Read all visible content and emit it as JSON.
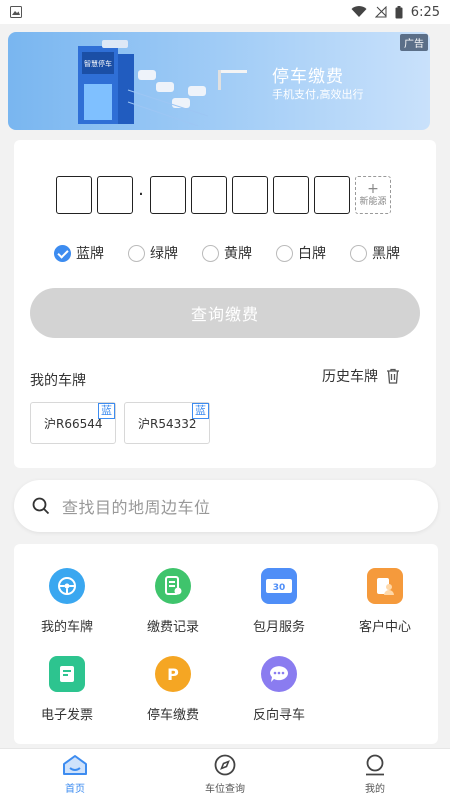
{
  "status_bar": {
    "time": "6:25"
  },
  "banner": {
    "ad_tag": "广告",
    "title": "停车缴费",
    "subtitle": "手机支付,高效出行",
    "building_sign": "智慧停车",
    "brand_color": "#79b6f0"
  },
  "plate_input": {
    "new_energy_plus": "+",
    "new_energy_label": "新能源"
  },
  "plate_colors": [
    {
      "label": "蓝牌",
      "checked": true
    },
    {
      "label": "绿牌",
      "checked": false
    },
    {
      "label": "黄牌",
      "checked": false
    },
    {
      "label": "白牌",
      "checked": false
    },
    {
      "label": "黑牌",
      "checked": false
    }
  ],
  "query_button": "查询缴费",
  "my_plates_title": "我的车牌",
  "history_title": "历史车牌",
  "plates": [
    {
      "number": "沪R66544",
      "tag": "蓝"
    },
    {
      "number": "沪R54332",
      "tag": "蓝"
    }
  ],
  "search": {
    "placeholder": "查找目的地周边车位"
  },
  "services": [
    {
      "label": "我的车牌",
      "icon": "steering-wheel-icon",
      "color": "#3aa7f0"
    },
    {
      "label": "缴费记录",
      "icon": "receipt-icon",
      "color": "#3fc46c"
    },
    {
      "label": "包月服务",
      "icon": "ticket-30-icon",
      "color": "#4f8ef7"
    },
    {
      "label": "客户中心",
      "icon": "customer-icon",
      "color": "#f59a3c"
    },
    {
      "label": "电子发票",
      "icon": "invoice-icon",
      "color": "#2dc48f"
    },
    {
      "label": "停车缴费",
      "icon": "parking-p-icon",
      "color": "#f5a623"
    },
    {
      "label": "反向寻车",
      "icon": "chat-bubble-icon",
      "color": "#8a7cf0"
    }
  ],
  "tabs": [
    {
      "label": "首页",
      "icon": "home-icon",
      "active": true
    },
    {
      "label": "车位查询",
      "icon": "compass-icon",
      "active": false
    },
    {
      "label": "我的",
      "icon": "profile-icon",
      "active": false
    }
  ],
  "accent_color": "#3d8cf0"
}
